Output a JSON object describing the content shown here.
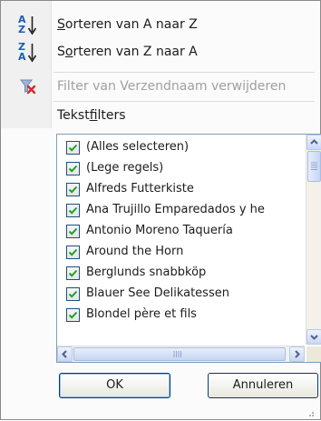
{
  "menu": {
    "items": [
      {
        "label": "Sorteren van A naar Z",
        "mnemonic": "S",
        "icon": "sort-a-to-z-icon",
        "enabled": true
      },
      {
        "label": "Sorteren van Z naar A",
        "mnemonic": "o",
        "icon": "sort-z-to-a-icon",
        "enabled": true
      },
      {
        "label": "Filter van Verzendnaam verwijderen",
        "icon": "clear-filter-icon",
        "enabled": false
      },
      {
        "label": "Tekstfilters",
        "mnemonic": "f",
        "enabled": true
      }
    ]
  },
  "sort_icon_letters": {
    "a": "A",
    "z": "Z"
  },
  "list": {
    "items": [
      {
        "label": "(Alles selecteren)",
        "checked": true
      },
      {
        "label": "(Lege regels)",
        "checked": true
      },
      {
        "label": "Alfreds Futterkiste",
        "checked": true
      },
      {
        "label": "Ana Trujillo Emparedados y he",
        "checked": true
      },
      {
        "label": "Antonio Moreno Taquería",
        "checked": true
      },
      {
        "label": "Around the Horn",
        "checked": true
      },
      {
        "label": "Berglunds snabbköp",
        "checked": true
      },
      {
        "label": "Blauer See Delikatessen",
        "checked": true
      },
      {
        "label": "Blondel père et fils",
        "checked": true
      }
    ]
  },
  "buttons": {
    "ok": "OK",
    "cancel": "Annuleren"
  },
  "colors": {
    "checkmark": "#21a121",
    "accent_blue": "#1a5fb4",
    "clear_filter_red": "#d42a2a"
  }
}
